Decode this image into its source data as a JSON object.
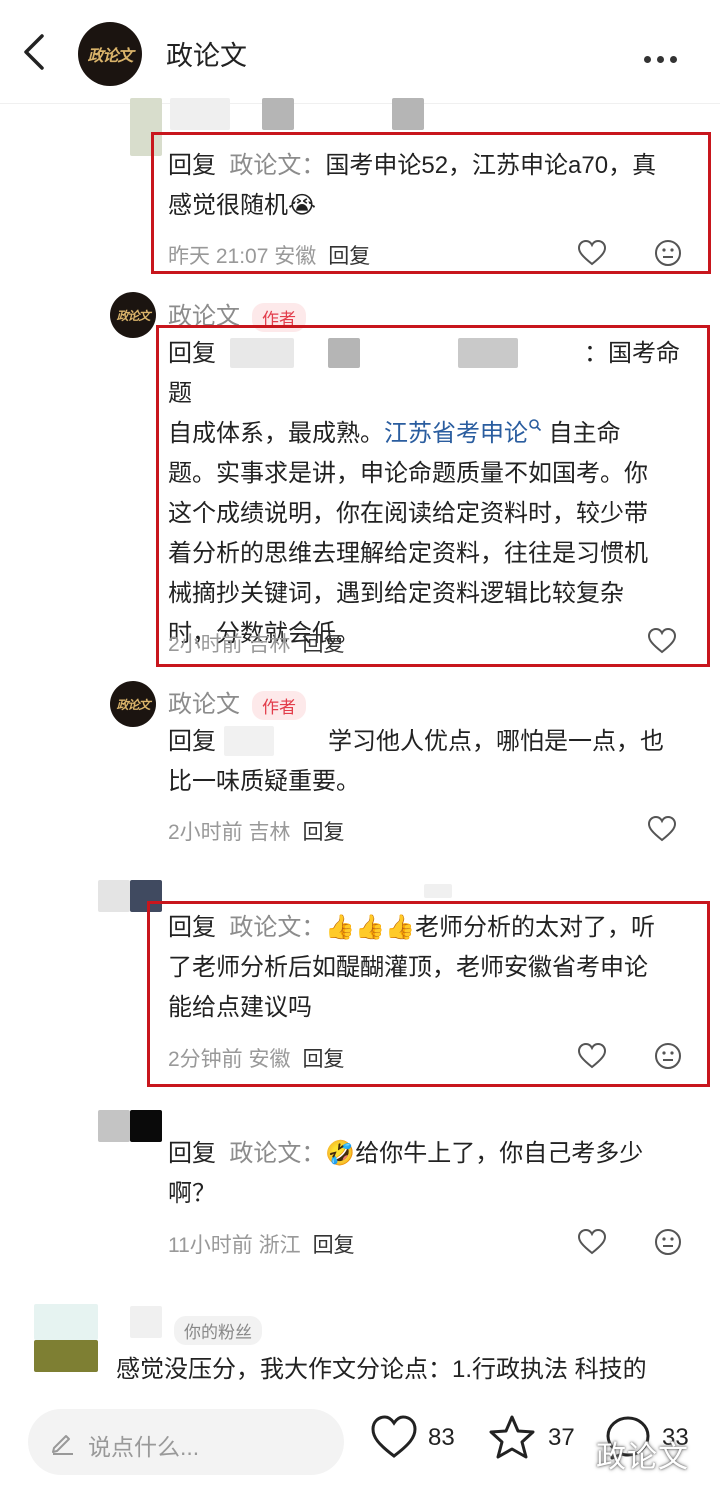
{
  "header": {
    "title": "政论文",
    "logo": "政论文"
  },
  "c1": {
    "prefix": "回复",
    "target": "政论文：",
    "line1": "国考申论52，江苏申论a70，真",
    "line2": "感觉很随机",
    "emoji": "😭",
    "time": "昨天 21:07 安徽",
    "reply": "回复"
  },
  "c2": {
    "name": "政论文",
    "tag": "作者",
    "prefix": "回复",
    "line1_tail": "：国考命题",
    "line2a": "自成体系，最成熟。",
    "link": "江苏省考申论",
    "link_icon": "search-icon",
    "line2b": "自主命",
    "line3": "题。实事求是讲，申论命题质量不如国考。你",
    "line4": "这个成绩说明，你在阅读给定资料时，较少带",
    "line5": "着分析的思维去理解给定资料，往往是习惯机",
    "line6": "械摘抄关键词，遇到给定资料逻辑比较复杂",
    "line7": "时，分数就会低。",
    "time": "2小时前 吉林",
    "reply": "回复"
  },
  "c3": {
    "name": "政论文",
    "tag": "作者",
    "prefix": "回复",
    "line1_tail": "学习他人优点，哪怕是一点，也",
    "line2": "比一味质疑重要。",
    "time": "2小时前 吉林",
    "reply": "回复"
  },
  "c4": {
    "prefix": "回复",
    "target": "政论文：",
    "emoji": "👍👍👍",
    "line1": "老师分析的太对了，听",
    "line2": "了老师分析后如醍醐灌顶，老师安徽省考申论",
    "line3": "能给点建议吗",
    "time": "2分钟前 安徽",
    "reply": "回复"
  },
  "c5": {
    "prefix": "回复",
    "target": "政论文：",
    "emoji": "🤣",
    "line1": "给你牛上了，你自己考多少",
    "line2": "啊？",
    "time": "11小时前 浙江",
    "reply": "回复"
  },
  "c6": {
    "tag": "你的粉丝",
    "line1": "感觉没压分，我大作文分论点：1.行政执法 科技的"
  },
  "bottom": {
    "placeholder": "说点什么...",
    "likes": "83",
    "stars": "37",
    "comments": "33"
  },
  "watermark": "政论文",
  "colors": {
    "highlight": "#c8161d",
    "author_tag": "#e23d4b",
    "link": "#2a5d9f"
  }
}
